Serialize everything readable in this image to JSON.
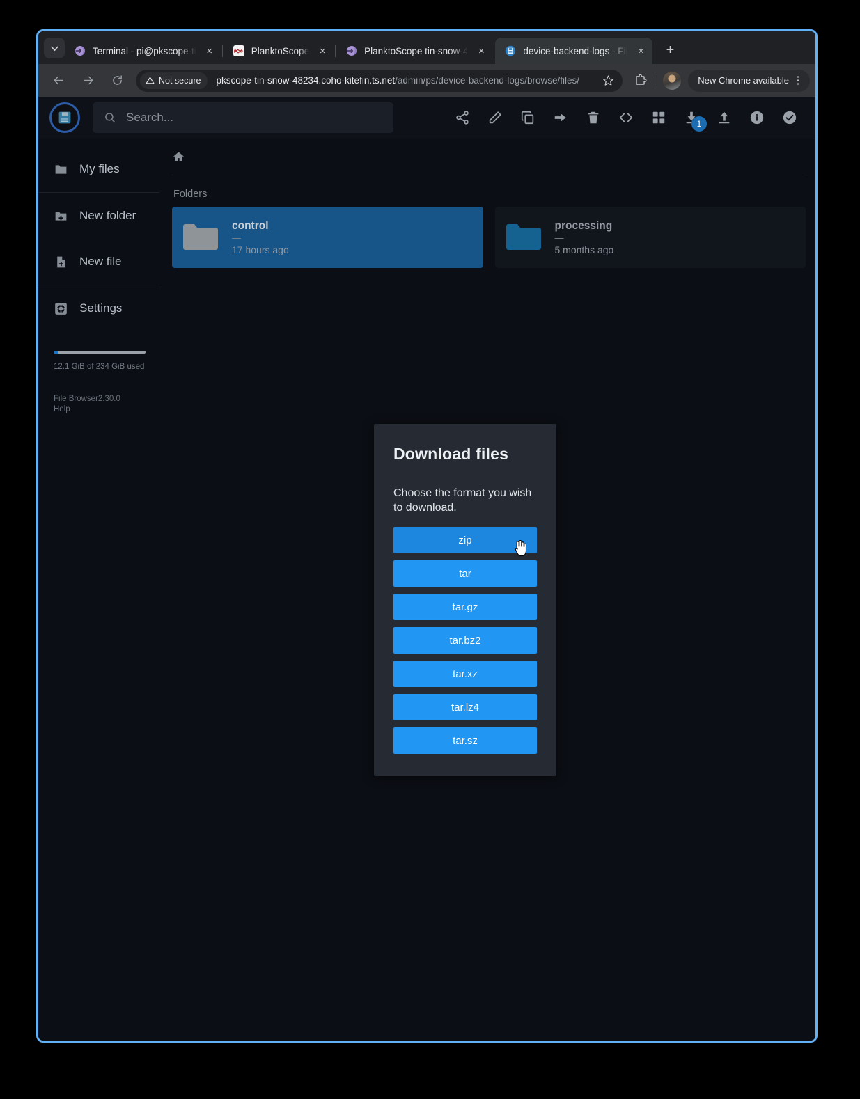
{
  "browser": {
    "tabs": [
      {
        "title": "Terminal - pi@pkscope-ti",
        "favicon": "globe-purple-icon",
        "active": false
      },
      {
        "title": "PlanktoScope",
        "favicon": "planktoscope-icon",
        "active": false
      },
      {
        "title": "PlanktoScope tin-snow-4",
        "favicon": "globe-purple-icon",
        "active": false
      },
      {
        "title": "device-backend-logs - Fil",
        "favicon": "filebrowser-icon",
        "active": true
      }
    ],
    "new_tab_label": "+",
    "close_label": "×",
    "security_chip": "Not secure",
    "url_host": "pkscope-tin-snow-48234.coho-kitefin.ts.net",
    "url_path": "/admin/ps/device-backend-logs/browse/files/",
    "update_pill": "New Chrome available",
    "kebab": "⋮",
    "accent_focus_ring": "#62b0f5"
  },
  "app": {
    "search": {
      "placeholder": "Search..."
    },
    "toolbar": [
      {
        "name": "share-icon",
        "badge": null
      },
      {
        "name": "rename-pencil-icon",
        "badge": null
      },
      {
        "name": "copy-icon",
        "badge": null
      },
      {
        "name": "move-arrow-icon",
        "badge": null
      },
      {
        "name": "delete-trash-icon",
        "badge": null
      },
      {
        "name": "code-brackets-icon",
        "badge": null
      },
      {
        "name": "grid-view-icon",
        "badge": null
      },
      {
        "name": "download-icon",
        "badge": "1"
      },
      {
        "name": "upload-icon",
        "badge": null
      },
      {
        "name": "info-icon",
        "badge": null
      },
      {
        "name": "select-all-check-icon",
        "badge": null
      }
    ],
    "sidebar": {
      "items": [
        {
          "label": "My files",
          "icon": "folder-icon"
        },
        {
          "label": "New folder",
          "icon": "folder-plus-icon"
        },
        {
          "label": "New file",
          "icon": "file-plus-icon"
        },
        {
          "label": "Settings",
          "icon": "gear-icon"
        }
      ],
      "storage_text": "12.1 GiB of 234 GiB used",
      "storage_percent": 5.2,
      "version": "File Browser2.30.0",
      "help": "Help"
    },
    "main": {
      "breadcrumb_icon": "home-icon",
      "folders_heading": "Folders",
      "folders": [
        {
          "name": "control",
          "size": "—",
          "modified": "17 hours ago",
          "selected": true
        },
        {
          "name": "processing",
          "size": "—",
          "modified": "5 months ago",
          "selected": false
        }
      ]
    },
    "modal": {
      "title": "Download files",
      "description": "Choose the format you wish to download.",
      "formats": [
        {
          "label": "zip",
          "hovered": true
        },
        {
          "label": "tar",
          "hovered": false
        },
        {
          "label": "tar.gz",
          "hovered": false
        },
        {
          "label": "tar.bz2",
          "hovered": false
        },
        {
          "label": "tar.xz",
          "hovered": false
        },
        {
          "label": "tar.lz4",
          "hovered": false
        },
        {
          "label": "tar.sz",
          "hovered": false
        }
      ]
    },
    "colors": {
      "accent_blue": "#2196f3",
      "accent_blue_hover": "#1d87df",
      "selection_blue": "#175488",
      "badge_blue": "#1b6cb0",
      "app_bg": "#0b0e14",
      "modal_bg": "#252a33"
    }
  }
}
